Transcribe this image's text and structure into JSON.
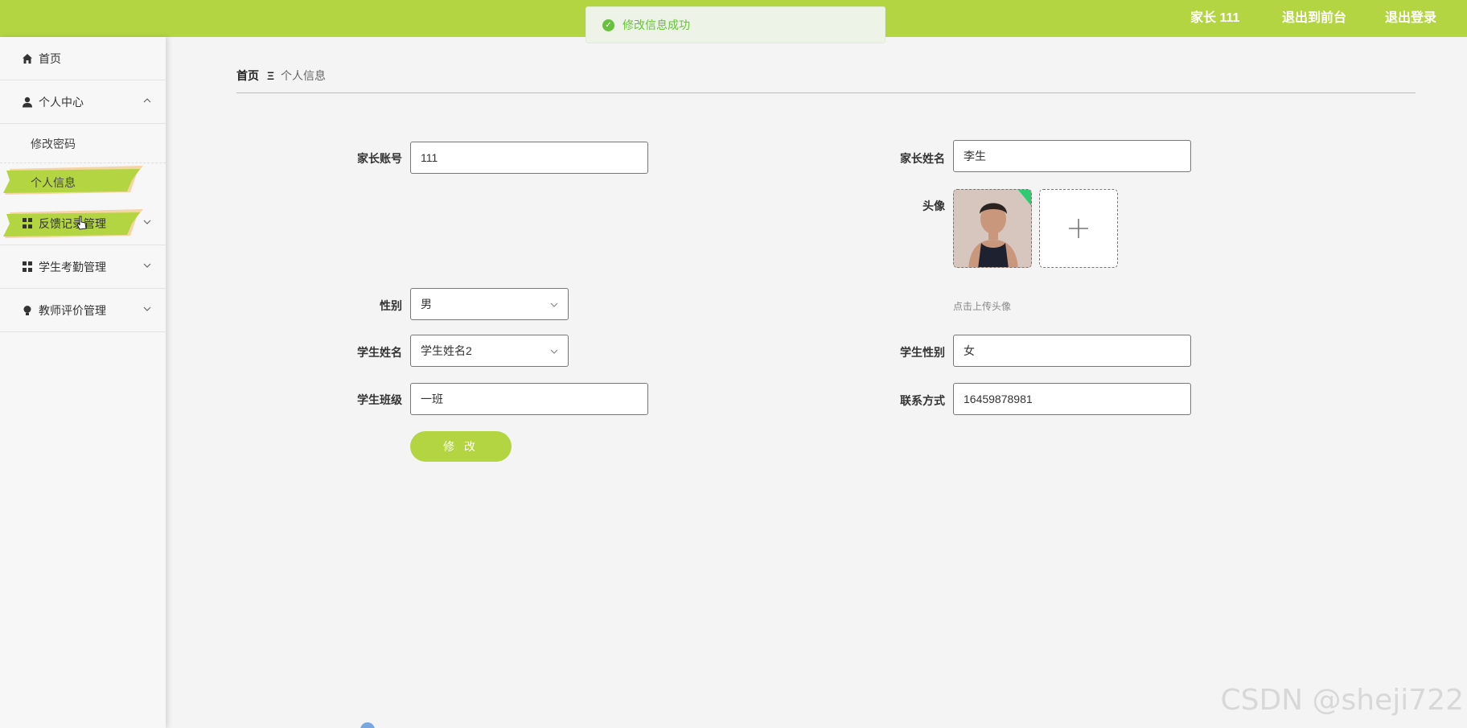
{
  "topbar": {
    "user_label": "家长 111",
    "exit_front": "退出到前台",
    "logout": "退出登录"
  },
  "toast": {
    "message": "修改信息成功"
  },
  "sidebar": {
    "home": "首页",
    "personal_center": "个人中心",
    "change_password": "修改密码",
    "personal_info": "个人信息",
    "feedback": "反馈记录管理",
    "attendance": "学生考勤管理",
    "evaluation": "教师评价管理"
  },
  "breadcrumb": {
    "home": "首页",
    "separator": "Ξ",
    "current": "个人信息"
  },
  "form": {
    "account_label": "家长账号",
    "account_value": "111",
    "name_label": "家长姓名",
    "name_value": "李生",
    "avatar_label": "头像",
    "upload_hint": "点击上传头像",
    "gender_label": "性别",
    "gender_value": "男",
    "student_name_label": "学生姓名",
    "student_name_value": "学生姓名2",
    "student_gender_label": "学生性别",
    "student_gender_value": "女",
    "class_label": "学生班级",
    "class_value": "一班",
    "contact_label": "联系方式",
    "contact_value": "16459878981",
    "submit": "修 改"
  },
  "watermark": "CSDN @sheji722",
  "colors": {
    "accent": "#b2d541",
    "success": "#67c23a"
  }
}
